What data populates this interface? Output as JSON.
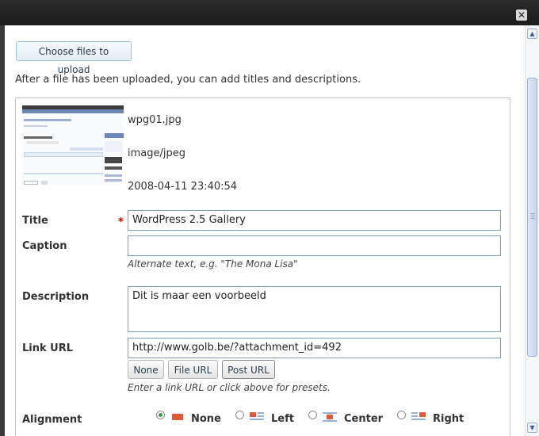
{
  "window": {
    "close_glyph": "✕"
  },
  "upload": {
    "choose_label": "Choose files to upload",
    "intro_text": "After a file has been uploaded, you can add titles and descriptions."
  },
  "file": {
    "name": "wpg01.jpg",
    "mime": "image/jpeg",
    "date": "2008-04-11 23:40:54"
  },
  "form": {
    "title_label": "Title",
    "title_value": "WordPress 2.5 Gallery",
    "required_mark": "*",
    "caption_label": "Caption",
    "caption_value": "",
    "caption_help": "Alternate text, e.g. \"The Mona Lisa\"",
    "description_label": "Description",
    "description_value": "Dit is maar een voorbeeld",
    "link_label": "Link URL",
    "link_value": "http://www.golb.be/?attachment_id=492",
    "link_buttons": [
      "None",
      "File URL",
      "Post URL"
    ],
    "link_help": "Enter a link URL or click above for presets.",
    "alignment_label": "Alignment",
    "alignment_options": [
      "None",
      "Left",
      "Center",
      "Right"
    ],
    "alignment_selected": "None"
  },
  "colors": {
    "accent_red": "#e05a3a",
    "radio_green": "#3a9c3a",
    "field_border": "#7d9fbd"
  }
}
